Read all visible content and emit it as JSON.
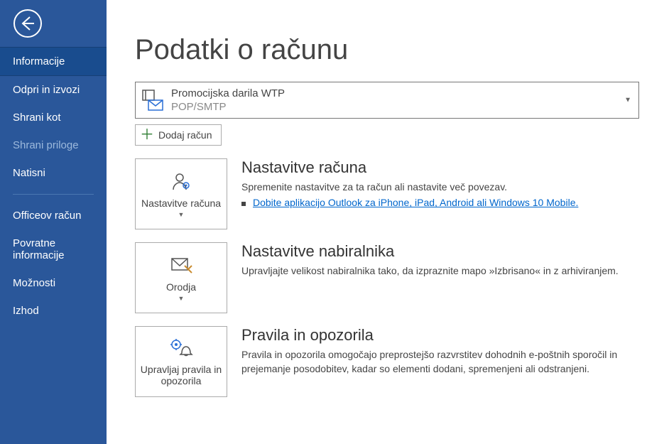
{
  "sidebar": {
    "items": [
      {
        "label": "Informacije",
        "active": true
      },
      {
        "label": "Odpri in izvozi"
      },
      {
        "label": "Shrani kot"
      },
      {
        "label": "Shrani priloge",
        "disabled": true
      },
      {
        "label": "Natisni"
      }
    ],
    "items2": [
      {
        "label": "Officeov račun"
      },
      {
        "label": "Povratne informacije"
      },
      {
        "label": "Možnosti"
      },
      {
        "label": "Izhod"
      }
    ]
  },
  "title": "Podatki o računu",
  "account": {
    "name": "Promocijska darila WTP",
    "protocol": "POP/SMTP"
  },
  "add_account_label": "Dodaj račun",
  "sections": {
    "settings": {
      "btn_label": "Nastavitve računa",
      "heading": "Nastavitve računa",
      "desc": "Spremenite nastavitve za ta račun ali nastavite več povezav.",
      "link": "Dobite aplikacijo Outlook za iPhone, iPad, Android ali Windows 10 Mobile."
    },
    "mailbox": {
      "btn_label": "Orodja",
      "heading": "Nastavitve nabiralnika",
      "desc": "Upravljajte velikost nabiralnika tako, da izpraznite mapo »Izbrisano« in z arhiviranjem."
    },
    "rules": {
      "btn_label": "Upravljaj pravila in opozorila",
      "heading": "Pravila in opozorila",
      "desc": "Pravila in opozorila omogočajo preprostejšo razvrstitev dohodnih e-poštnih sporočil in prejemanje posodobitev, kadar so elementi dodani, spremenjeni ali odstranjeni."
    }
  }
}
